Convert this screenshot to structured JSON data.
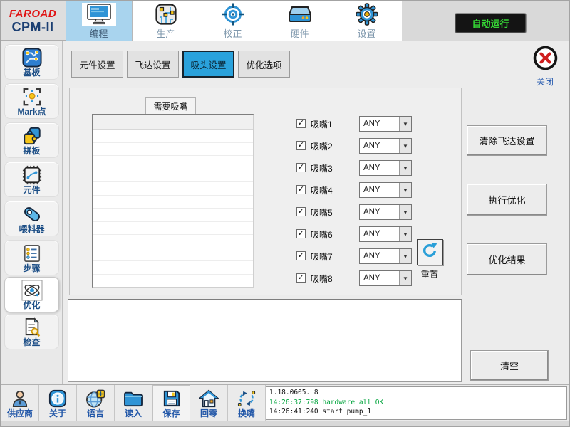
{
  "brand": {
    "name": "FAROAD",
    "model": "CPM-II"
  },
  "top_nav": {
    "tabs": [
      {
        "label": "编程",
        "icon": "monitor-icon",
        "selected": true
      },
      {
        "label": "生产",
        "icon": "circuit-icon",
        "selected": false
      },
      {
        "label": "校正",
        "icon": "target-icon",
        "selected": false
      },
      {
        "label": "硬件",
        "icon": "drive-icon",
        "selected": false
      },
      {
        "label": "设置",
        "icon": "gear-icon",
        "selected": false
      }
    ],
    "auto_run": "自动运行"
  },
  "sidebar": {
    "items": [
      {
        "label": "基板",
        "icon": "pcb-icon",
        "selected": false
      },
      {
        "label": "Mark点",
        "icon": "mark-icon",
        "selected": false
      },
      {
        "label": "拼板",
        "icon": "puzzle-icon",
        "selected": false
      },
      {
        "label": "元件",
        "icon": "chip-icon",
        "selected": false
      },
      {
        "label": "喂料器",
        "icon": "feeder-icon",
        "selected": false
      },
      {
        "label": "步骤",
        "icon": "steps-icon",
        "selected": false
      },
      {
        "label": "优化",
        "icon": "atom-icon",
        "selected": true
      },
      {
        "label": "检查",
        "icon": "inspect-icon",
        "selected": false
      }
    ]
  },
  "subtabs": {
    "tabs": [
      {
        "label": "元件设置",
        "selected": false
      },
      {
        "label": "飞达设置",
        "selected": false
      },
      {
        "label": "吸头设置",
        "selected": true
      },
      {
        "label": "优化选项",
        "selected": false
      }
    ]
  },
  "close_label": "关闭",
  "nozzles": {
    "panel_title": "需要吸嘴",
    "rows": [
      {
        "label": "吸嘴1",
        "value": "ANY",
        "checked": true
      },
      {
        "label": "吸嘴2",
        "value": "ANY",
        "checked": true
      },
      {
        "label": "吸嘴3",
        "value": "ANY",
        "checked": true
      },
      {
        "label": "吸嘴4",
        "value": "ANY",
        "checked": true
      },
      {
        "label": "吸嘴5",
        "value": "ANY",
        "checked": true
      },
      {
        "label": "吸嘴6",
        "value": "ANY",
        "checked": true
      },
      {
        "label": "吸嘴7",
        "value": "ANY",
        "checked": true
      },
      {
        "label": "吸嘴8",
        "value": "ANY",
        "checked": true
      }
    ],
    "reset_label": "重置"
  },
  "actions": {
    "clear_feeder": "清除飞达设置",
    "run_optimization": "执行优化",
    "optimization_result": "优化结果",
    "clear": "清空"
  },
  "toolbar": {
    "items": [
      {
        "label": "供应商",
        "icon": "person-icon"
      },
      {
        "label": "关于",
        "icon": "info-icon"
      },
      {
        "label": "语言",
        "icon": "globe-icon"
      },
      {
        "label": "读入",
        "icon": "folder-icon"
      },
      {
        "label": "保存",
        "icon": "save-icon"
      },
      {
        "label": "回零",
        "icon": "home-icon"
      },
      {
        "label": "换嘴",
        "icon": "swap-arrows-icon"
      }
    ]
  },
  "log": {
    "lines": [
      {
        "text": "1.18.0605. 8",
        "color": "#111111"
      },
      {
        "text": "14:26:37:798 hardware all OK",
        "color": "#00a43c"
      },
      {
        "text": "14:26:41:240 start pump_1",
        "color": "#111111"
      }
    ]
  },
  "colors": {
    "selected_top_tab_bg": "#a9d4ee",
    "selected_subtab_bg": "#2aa2dc",
    "autorun_green": "#35d435",
    "log_green": "#00a43c",
    "brand_red": "#e01212",
    "brand_navy": "#1b3f72",
    "sidebar_label_blue": "#1c4e86",
    "toolbar_label_blue": "#2257a8"
  }
}
